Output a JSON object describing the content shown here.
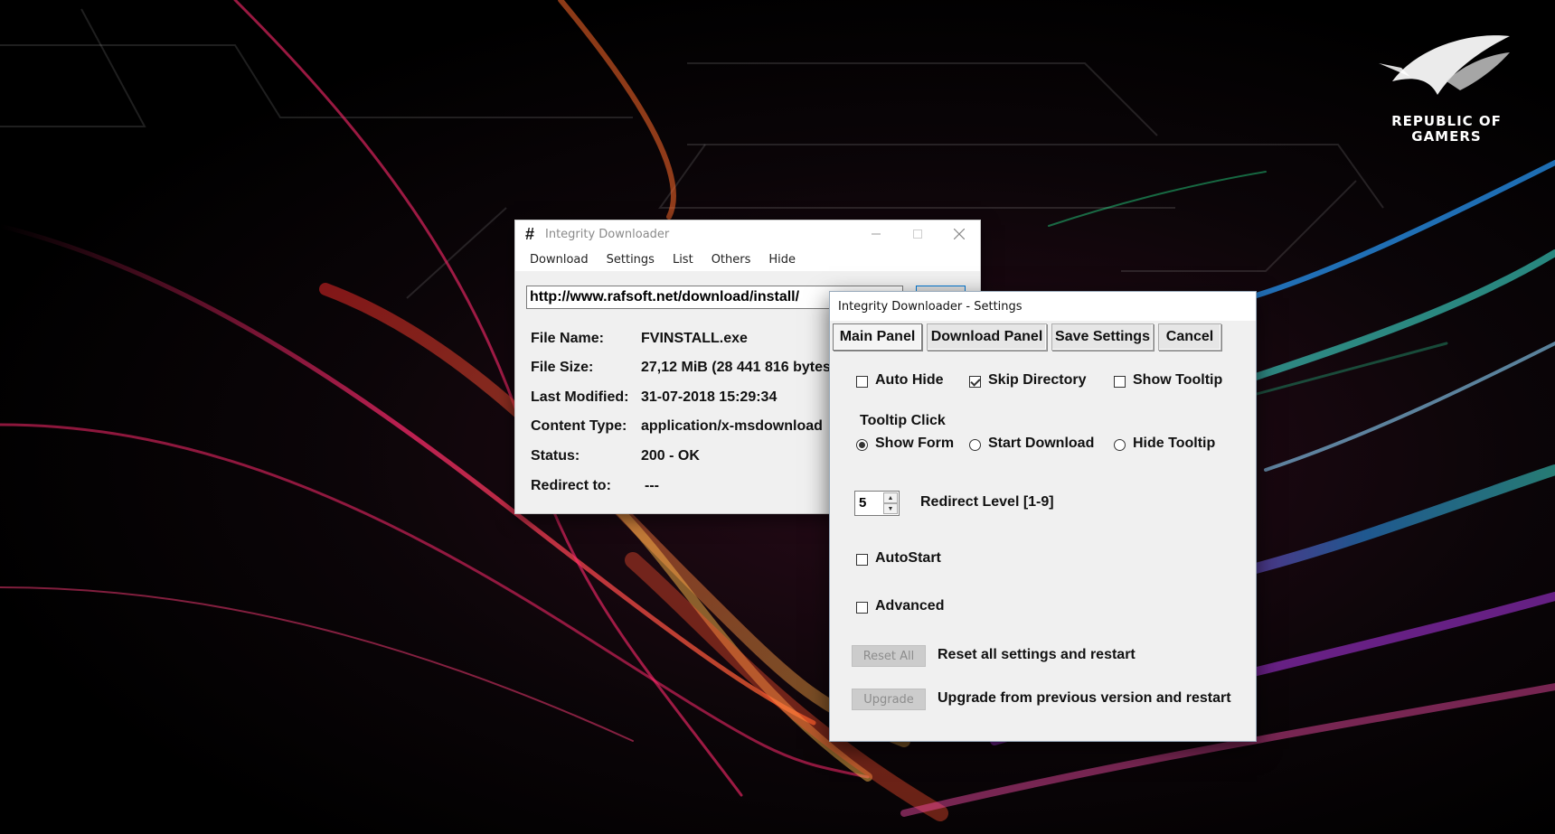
{
  "wallpaper": {
    "logo_line1": "REPUBLIC OF",
    "logo_line2": "GAMERS",
    "accent_colors": [
      "#ff2a6d",
      "#ff6a2a",
      "#2a9dff",
      "#3fe0d0",
      "#c23cff"
    ]
  },
  "main_window": {
    "title": "Integrity Downloader",
    "icon": "hash-icon",
    "menu": [
      "Download",
      "Settings",
      "List",
      "Others",
      "Hide"
    ],
    "url": "http://www.rafsoft.net/download/install/",
    "fields": [
      {
        "label": "File Name:",
        "value": "FVINSTALL.exe"
      },
      {
        "label": "File Size:",
        "value": "27,12 MiB (28 441 816 bytes)"
      },
      {
        "label": "Last Modified:",
        "value": "31-07-2018 15:29:34"
      },
      {
        "label": "Content Type:",
        "value": "application/x-msdownload"
      },
      {
        "label": "Status:",
        "value": "200 - OK"
      },
      {
        "label": "Redirect to:",
        "value": "---"
      }
    ]
  },
  "settings_window": {
    "title": "Integrity Downloader - Settings",
    "tabs": [
      "Main Panel",
      "Download Panel",
      "Save Settings",
      "Cancel"
    ],
    "active_tab": "Main Panel",
    "checkboxes_row1": [
      {
        "label": "Auto Hide",
        "checked": false
      },
      {
        "label": "Skip Directory",
        "checked": true
      },
      {
        "label": "Show Tooltip",
        "checked": false
      }
    ],
    "tooltip_click": {
      "label": "Tooltip Click",
      "options": [
        {
          "label": "Show Form",
          "selected": true
        },
        {
          "label": "Start Download",
          "selected": false
        },
        {
          "label": "Hide Tooltip",
          "selected": false
        }
      ]
    },
    "redirect": {
      "value": "5",
      "label": "Redirect Level [1-9]"
    },
    "autostart": {
      "label": "AutoStart",
      "checked": false
    },
    "advanced": {
      "label": "Advanced",
      "checked": false
    },
    "reset": {
      "button": "Reset All",
      "description": "Reset all settings and restart"
    },
    "upgrade": {
      "button": "Upgrade",
      "description": "Upgrade from previous version and restart"
    }
  }
}
